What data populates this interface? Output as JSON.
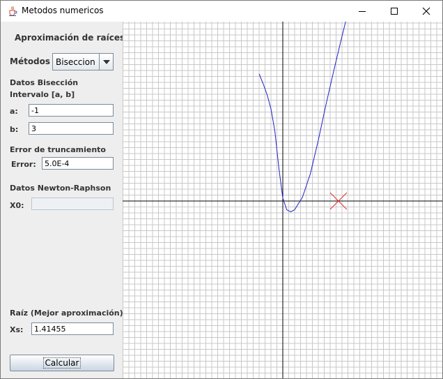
{
  "window": {
    "title": "Metodos numericos"
  },
  "panel": {
    "heading": "Aproximación de raíces",
    "methods_label": "Métodos",
    "method_selected": "Biseccion",
    "bisection_title": "Datos Bisección",
    "interval_label": "Intervalo [a, b]",
    "a_label": "a:",
    "a_value": "-1",
    "b_label": "b:",
    "b_value": "3",
    "error_title": "Error de truncamiento",
    "error_label": "Error:",
    "error_value": "5.0E-4",
    "newton_title": "Datos Newton-Raphson",
    "x0_label": "X0:",
    "x0_value": "",
    "root_title": "Raíz (Mejor aproximación)",
    "xs_label": "Xs:",
    "xs_value": "1.41455",
    "calc_button": "Calcular"
  },
  "icons": {
    "app": "java-cup-icon",
    "minimize": "minimize-icon",
    "maximize": "maximize-icon",
    "close": "close-icon",
    "dropdown": "chevron-down-icon",
    "root_marker": "x-marker-icon"
  },
  "colors": {
    "curve": "#2020c8",
    "root_marker": "#e03030",
    "grid": "#c8c8c8",
    "axis": "#000000"
  },
  "chart_data": {
    "type": "line",
    "function_shape": "parabola",
    "series": [
      {
        "x": [
          -0.6,
          -0.5,
          -0.4,
          -0.3,
          -0.2,
          -0.1,
          0.0,
          0.1,
          0.2,
          0.3,
          0.5,
          0.7,
          0.9,
          1.1,
          1.3,
          1.5,
          1.65
        ],
        "y": [
          13.0,
          12.0,
          10.9,
          9.4,
          7.1,
          3.4,
          0.3,
          -0.9,
          -1.1,
          -0.9,
          0.4,
          2.8,
          6.2,
          9.9,
          13.4,
          16.8,
          19.2
        ]
      }
    ],
    "root_marker": {
      "x": 1.41455,
      "y": 0
    },
    "grid": true,
    "axes": "crossing-at-origin"
  }
}
